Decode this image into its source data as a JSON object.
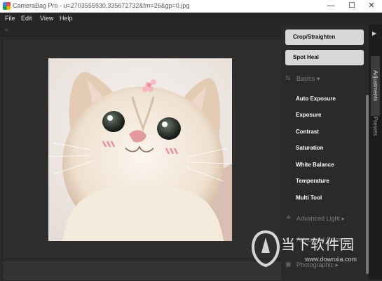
{
  "window": {
    "title": "CameraBag Pro - u=2703555930,335672732&fm=26&gp=0.jpg",
    "minimize": "—",
    "maximize": "☐",
    "close": "✕"
  },
  "menu": [
    "File",
    "Edit",
    "View",
    "Help"
  ],
  "toolbar": {
    "add": "+"
  },
  "panel": {
    "crop_label": "Crop/Straighten",
    "spot_heal_label": "Spot Heal",
    "basics_label": "Basics ▾",
    "adjustments": [
      "Auto Exposure",
      "Exposure",
      "Contrast",
      "Saturation",
      "White Balance",
      "Temperature",
      "Multi Tool"
    ],
    "advanced_light_label": "Advanced Light ▸",
    "advanced_color_label": "Advanced Color",
    "photographic_label": "Photographic ▸"
  },
  "rail": {
    "expand": "▶",
    "tabs": [
      "Adjustments",
      "Presets"
    ]
  },
  "watermark": {
    "brand": "当下软件园",
    "url": "www.downxia.com"
  },
  "colors": {
    "background": "#2b2b2b",
    "panel": "#2a2a2a",
    "button": "#d7d7d7",
    "text": "#ffffff"
  }
}
